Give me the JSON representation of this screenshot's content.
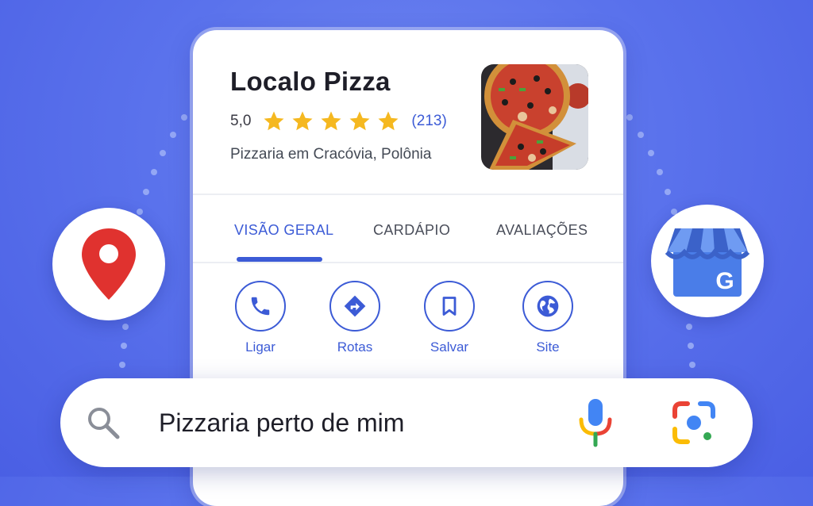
{
  "business": {
    "name": "Localo Pizza",
    "rating": "5,0",
    "stars": 5,
    "reviews_count": "(213)",
    "category": "Pizzaria em Cracóvia, Polônia",
    "photo_subject": "pizza-photo"
  },
  "tabs": [
    {
      "label": "VISÃO GERAL",
      "active": true
    },
    {
      "label": "CARDÁPIO",
      "active": false
    },
    {
      "label": "AVALIAÇÕES",
      "active": false
    }
  ],
  "actions": [
    {
      "label": "Ligar",
      "icon": "phone-icon"
    },
    {
      "label": "Rotas",
      "icon": "directions-icon"
    },
    {
      "label": "Salvar",
      "icon": "bookmark-icon"
    },
    {
      "label": "Site",
      "icon": "globe-icon"
    }
  ],
  "search": {
    "query": "Pizzaria perto de mim"
  },
  "badges": {
    "left": "google-maps-pin-icon",
    "right": "google-business-profile-icon",
    "right_letter": "G"
  },
  "colors": {
    "accent": "#3c5bd6",
    "star": "#f5b820",
    "background": "#5a72ec",
    "maps_red": "#e0322f",
    "gbp_blue": "#4a7de8"
  }
}
